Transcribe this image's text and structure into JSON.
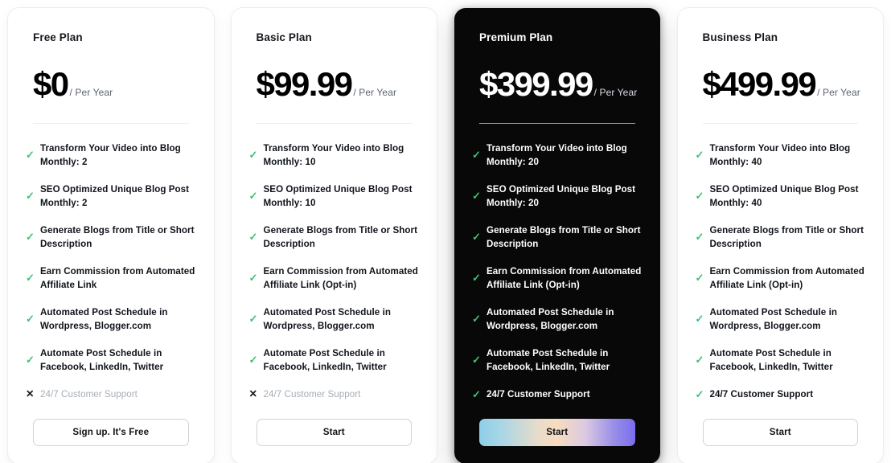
{
  "icons": {
    "check": "✓",
    "cross": "✕"
  },
  "colors": {
    "check_green": "#3fc17b",
    "muted_text": "#a7adb6",
    "dark_card_bg": "#080808"
  },
  "plans": [
    {
      "name": "Free Plan",
      "price": "$0",
      "period": "/ Per Year",
      "theme": "light",
      "features": [
        {
          "text": "Transform Your Video into Blog Monthly: 2",
          "included": true
        },
        {
          "text": "SEO Optimized Unique Blog Post Monthly: 2",
          "included": true
        },
        {
          "text": "Generate Blogs from Title or Short Description",
          "included": true
        },
        {
          "text": "Earn Commission from Automated Affiliate Link",
          "included": true
        },
        {
          "text": "Automated Post Schedule in Wordpress, Blogger.com",
          "included": true
        },
        {
          "text": "Automate Post Schedule in Facebook, LinkedIn, Twitter",
          "included": true
        },
        {
          "text": "24/7 Customer Support",
          "included": false
        }
      ],
      "cta": "Sign up. It's Free"
    },
    {
      "name": "Basic Plan",
      "price": "$99.99",
      "period": "/ Per Year",
      "theme": "light",
      "features": [
        {
          "text": "Transform Your Video into Blog Monthly: 10",
          "included": true
        },
        {
          "text": "SEO Optimized Unique Blog Post Monthly: 10",
          "included": true
        },
        {
          "text": "Generate Blogs from Title or Short Description",
          "included": true
        },
        {
          "text": "Earn Commission from Automated Affiliate Link (Opt-in)",
          "included": true
        },
        {
          "text": "Automated Post Schedule in Wordpress, Blogger.com",
          "included": true
        },
        {
          "text": "Automate Post Schedule in Facebook, LinkedIn, Twitter",
          "included": true
        },
        {
          "text": "24/7 Customer Support",
          "included": false
        }
      ],
      "cta": "Start"
    },
    {
      "name": "Premium Plan",
      "price": "$399.99",
      "period": "/ Per Year",
      "theme": "dark",
      "features": [
        {
          "text": "Transform Your Video into Blog Monthly: 20",
          "included": true
        },
        {
          "text": "SEO Optimized Unique Blog Post Monthly: 20",
          "included": true
        },
        {
          "text": "Generate Blogs from Title or Short Description",
          "included": true
        },
        {
          "text": "Earn Commission from Automated Affiliate Link (Opt-in)",
          "included": true
        },
        {
          "text": "Automated Post Schedule in Wordpress, Blogger.com",
          "included": true
        },
        {
          "text": "Automate Post Schedule in Facebook, LinkedIn, Twitter",
          "included": true
        },
        {
          "text": "24/7 Customer Support",
          "included": true
        }
      ],
      "cta": "Start"
    },
    {
      "name": "Business Plan",
      "price": "$499.99",
      "period": "/ Per Year",
      "theme": "light",
      "features": [
        {
          "text": "Transform Your Video into Blog Monthly: 40",
          "included": true
        },
        {
          "text": "SEO Optimized Unique Blog Post Monthly: 40",
          "included": true
        },
        {
          "text": "Generate Blogs from Title or Short Description",
          "included": true
        },
        {
          "text": "Earn Commission from Automated Affiliate Link (Opt-in)",
          "included": true
        },
        {
          "text": "Automated Post Schedule in Wordpress, Blogger.com",
          "included": true
        },
        {
          "text": "Automate Post Schedule in Facebook, LinkedIn, Twitter",
          "included": true
        },
        {
          "text": "24/7 Customer Support",
          "included": true
        }
      ],
      "cta": "Start"
    }
  ]
}
